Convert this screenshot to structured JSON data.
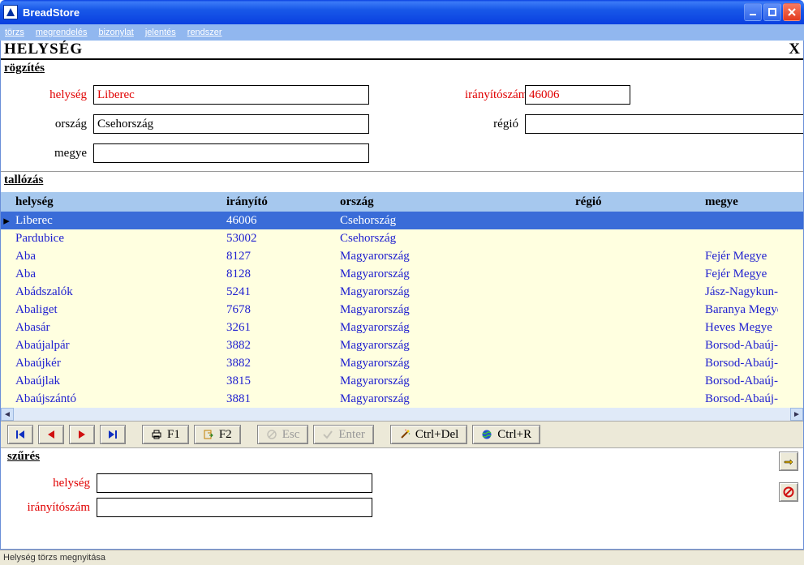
{
  "window": {
    "title": "BreadStore"
  },
  "menu": [
    "törzs",
    "megrendelés",
    "bizonylat",
    "jelentés",
    "rendszer"
  ],
  "page": {
    "title": "HELYSÉG",
    "close": "X"
  },
  "sections": {
    "record": "rögzítés",
    "browse": "tallózás",
    "filter": "szűrés"
  },
  "form": {
    "labels": {
      "helyseg": "helység",
      "iranyitoszam": "irányítószám",
      "orszag": "ország",
      "regio": "régió",
      "megye": "megye"
    },
    "values": {
      "helyseg": "Liberec",
      "iranyitoszam": "46006",
      "orszag": "Csehország",
      "regio": "",
      "megye": ""
    }
  },
  "table": {
    "headers": {
      "helyseg": "helység",
      "iranyito": "irányító",
      "orszag": "ország",
      "regio": "régió",
      "megye": "megye"
    },
    "rows": [
      {
        "helyseg": "Liberec",
        "iranyito": "46006",
        "orszag": "Csehország",
        "regio": "",
        "megye": "",
        "selected": true
      },
      {
        "helyseg": "Pardubice",
        "iranyito": "53002",
        "orszag": "Csehország",
        "regio": "",
        "megye": ""
      },
      {
        "helyseg": "Aba",
        "iranyito": "8127",
        "orszag": "Magyarország",
        "regio": "",
        "megye": "Fejér Megye"
      },
      {
        "helyseg": "Aba",
        "iranyito": "8128",
        "orszag": "Magyarország",
        "regio": "",
        "megye": "Fejér Megye"
      },
      {
        "helyseg": "Abádszalók",
        "iranyito": "5241",
        "orszag": "Magyarország",
        "regio": "",
        "megye": "Jász-Nagykun-Sz"
      },
      {
        "helyseg": "Abaliget",
        "iranyito": "7678",
        "orszag": "Magyarország",
        "regio": "",
        "megye": "Baranya Megye"
      },
      {
        "helyseg": "Abasár",
        "iranyito": "3261",
        "orszag": "Magyarország",
        "regio": "",
        "megye": "Heves Megye"
      },
      {
        "helyseg": "Abaújalpár",
        "iranyito": "3882",
        "orszag": "Magyarország",
        "regio": "",
        "megye": "Borsod-Abaúj-Ze"
      },
      {
        "helyseg": "Abaújkér",
        "iranyito": "3882",
        "orszag": "Magyarország",
        "regio": "",
        "megye": "Borsod-Abaúj-Ze"
      },
      {
        "helyseg": "Abaújlak",
        "iranyito": "3815",
        "orszag": "Magyarország",
        "regio": "",
        "megye": "Borsod-Abaúj-Ze"
      },
      {
        "helyseg": "Abaújszántó",
        "iranyito": "3881",
        "orszag": "Magyarország",
        "regio": "",
        "megye": "Borsod-Abaúj-Ze"
      }
    ]
  },
  "toolbar": {
    "f1": "F1",
    "f2": "F2",
    "esc": "Esc",
    "enter": "Enter",
    "ctrldel": "Ctrl+Del",
    "ctrlr": "Ctrl+R"
  },
  "filter": {
    "labels": {
      "helyseg": "helység",
      "iranyitoszam": "irányítószám"
    },
    "values": {
      "helyseg": "",
      "iranyitoszam": ""
    }
  },
  "status": "Helység törzs megnyitása"
}
